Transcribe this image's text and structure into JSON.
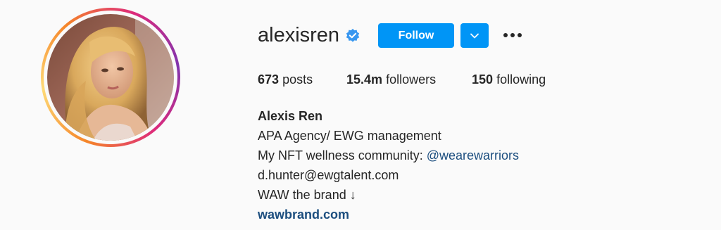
{
  "profile": {
    "username": "alexisren",
    "verified": true,
    "follow_label": "Follow",
    "avatar_icon": "profile-photo",
    "verified_icon": "verified-badge-icon",
    "dropdown_icon": "chevron-down-icon",
    "more_icon": "more-options-icon"
  },
  "stats": {
    "posts_count": "673",
    "posts_label": "posts",
    "followers_count": "15.4m",
    "followers_label": "followers",
    "following_count": "150",
    "following_label": "following"
  },
  "bio": {
    "full_name": "Alexis Ren",
    "line1": "APA Agency/ EWG management",
    "line2_prefix": "My NFT wellness community: ",
    "line2_mention": "@wearewarriors",
    "line3": "d.hunter@ewgtalent.com",
    "line4": "WAW the brand ↓",
    "website": "wawbrand.com"
  },
  "colors": {
    "background": "#fafafa",
    "button_blue": "#0095f6",
    "link_blue": "#1c4e7f",
    "verified_blue": "#3897f0",
    "text": "#262626"
  }
}
